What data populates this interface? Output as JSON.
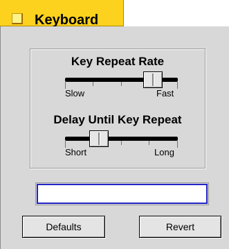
{
  "tab": {
    "title": "Keyboard",
    "icon": "folder-icon"
  },
  "key_repeat_rate": {
    "title": "Key Repeat Rate",
    "min_label": "Slow",
    "max_label": "Fast",
    "value_fraction": 0.78
  },
  "delay_until_repeat": {
    "title": "Delay Until Key Repeat",
    "min_label": "Short",
    "max_label": "Long",
    "value_fraction": 0.3
  },
  "text_field": {
    "value": ""
  },
  "buttons": {
    "defaults_label": "Defaults",
    "revert_label": "Revert"
  },
  "colors": {
    "tab_background": "#fcd21f",
    "window_background": "#d8d8d8",
    "focus_ring": "#2424c8"
  }
}
